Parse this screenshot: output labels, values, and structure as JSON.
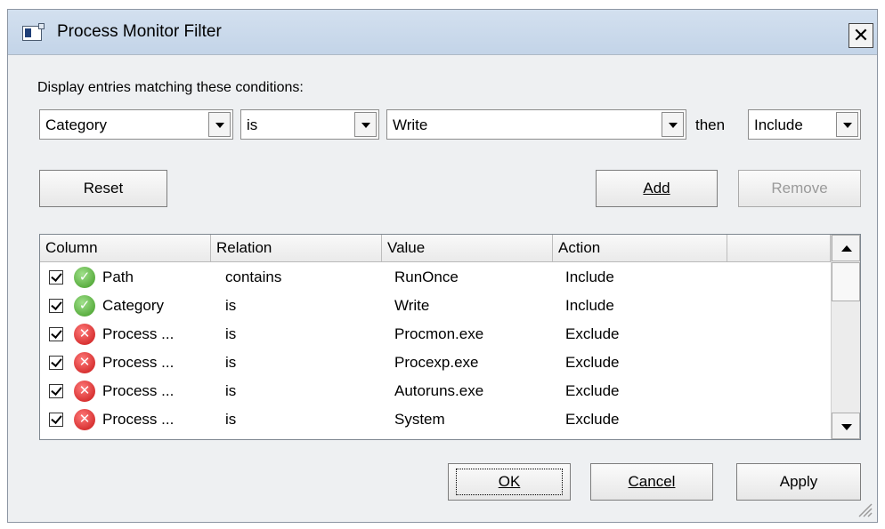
{
  "window": {
    "title": "Process Monitor Filter",
    "close_label": "✕"
  },
  "conditions": {
    "label": "Display entries matching these conditions:",
    "column_value": "Category",
    "relation_value": "is",
    "value_value": "Write",
    "then_label": "then",
    "action_value": "Include"
  },
  "buttons": {
    "reset": "Reset",
    "add": "Add",
    "remove": "Remove",
    "ok": "OK",
    "cancel": "Cancel",
    "apply": "Apply"
  },
  "table": {
    "headers": [
      "Column",
      "Relation",
      "Value",
      "Action"
    ],
    "rows": [
      {
        "checked": true,
        "status": "include",
        "column": "Path",
        "relation": "contains",
        "value": "RunOnce",
        "action": "Include"
      },
      {
        "checked": true,
        "status": "include",
        "column": "Category",
        "relation": "is",
        "value": "Write",
        "action": "Include"
      },
      {
        "checked": true,
        "status": "exclude",
        "column": "Process ...",
        "relation": "is",
        "value": "Procmon.exe",
        "action": "Exclude"
      },
      {
        "checked": true,
        "status": "exclude",
        "column": "Process ...",
        "relation": "is",
        "value": "Procexp.exe",
        "action": "Exclude"
      },
      {
        "checked": true,
        "status": "exclude",
        "column": "Process ...",
        "relation": "is",
        "value": "Autoruns.exe",
        "action": "Exclude"
      },
      {
        "checked": true,
        "status": "exclude",
        "column": "Process ...",
        "relation": "is",
        "value": "System",
        "action": "Exclude"
      }
    ]
  },
  "icons": {
    "include": "check-circle-icon",
    "exclude": "x-circle-icon"
  },
  "colors": {
    "include": "#3f9a23",
    "exclude": "#c81616",
    "titlebar": "#c9d8ea"
  }
}
